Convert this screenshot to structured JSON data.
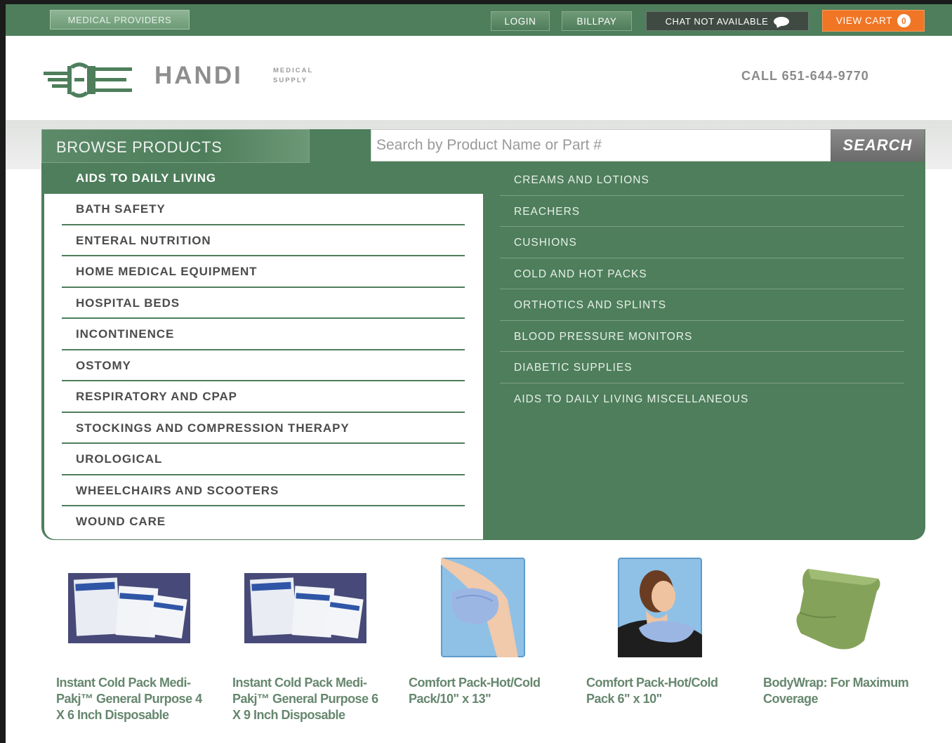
{
  "topbar": {
    "medical_providers": "MEDICAL PROVIDERS",
    "login": "LOGIN",
    "billpay": "BILLPAY",
    "chat": "CHAT NOT AVAILABLE",
    "view_cart": "VIEW CART",
    "cart_count": "0"
  },
  "header": {
    "brand": "HANDI",
    "brand_sub_1": "MEDICAL",
    "brand_sub_2": "SUPPLY",
    "phone": "CALL 651-644-9770"
  },
  "browse": {
    "title": "BROWSE PRODUCTS",
    "active_category": "AIDS TO DAILY LIVING",
    "categories": [
      "BATH SAFETY",
      "ENTERAL NUTRITION",
      "HOME MEDICAL EQUIPMENT",
      "HOSPITAL BEDS",
      "INCONTINENCE",
      "OSTOMY",
      "RESPIRATORY AND CPAP",
      "STOCKINGS AND COMPRESSION THERAPY",
      "UROLOGICAL",
      "WHEELCHAIRS AND SCOOTERS",
      "WOUND CARE"
    ],
    "subcategories": [
      "CREAMS AND LOTIONS",
      "REACHERS",
      "CUSHIONS",
      "COLD AND HOT PACKS",
      "ORTHOTICS AND SPLINTS",
      "BLOOD PRESSURE MONITORS",
      "DIABETIC SUPPLIES",
      "AIDS TO DAILY LIVING MISCELLANEOUS"
    ]
  },
  "search": {
    "placeholder": "Search by Product Name or Part #",
    "button": "SEARCH"
  },
  "products": [
    {
      "title": "Instant Cold Pack Medi-Pakj™ General Purpose 4 X 6 Inch Disposable"
    },
    {
      "title": "Instant Cold Pack Medi-Pakj™ General Purpose 6 X 9 Inch Disposable"
    },
    {
      "title": "Comfort Pack-Hot/Cold Pack/10\" x 13\""
    },
    {
      "title": "Comfort Pack-Hot/Cold Pack 6\" x 10\""
    },
    {
      "title": "BodyWrap: For Maximum Coverage"
    }
  ],
  "colors": {
    "brand_green": "#4e7e5b",
    "cart_orange": "#f07626",
    "product_title": "#66876e"
  }
}
